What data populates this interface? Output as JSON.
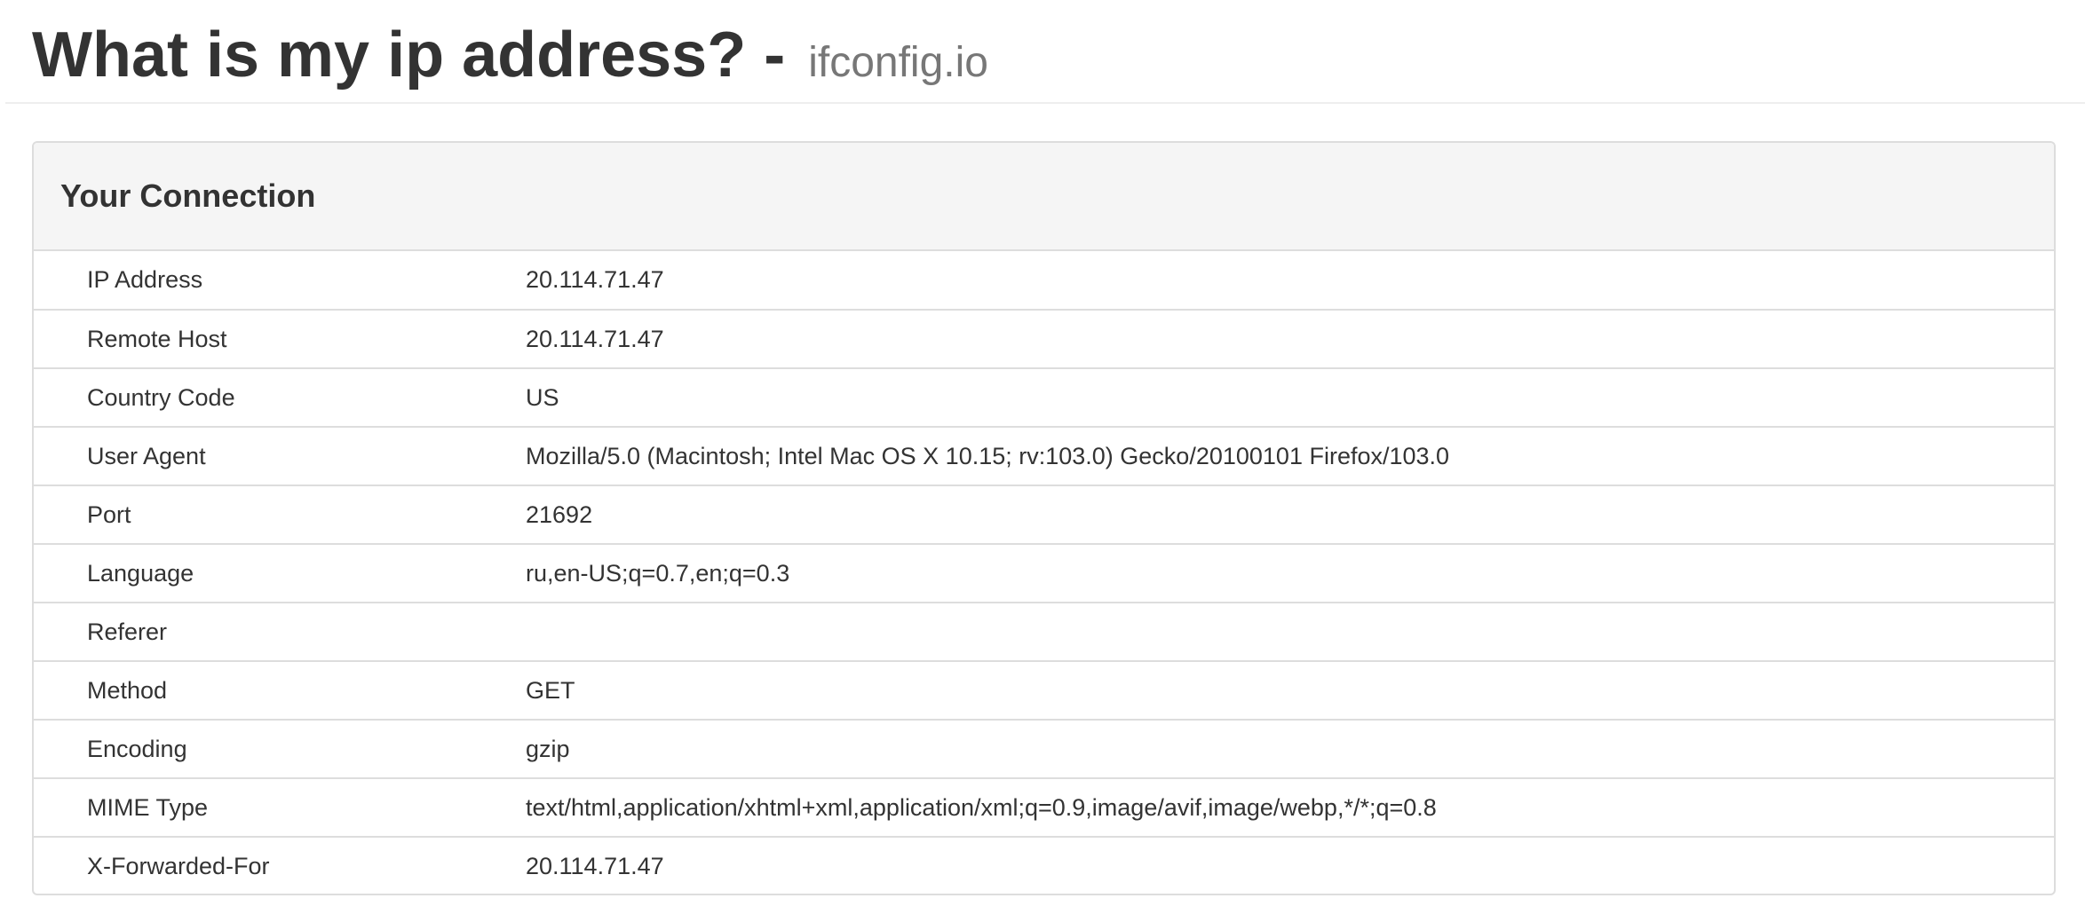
{
  "header": {
    "title": "What is my ip address? -",
    "subtitle": "ifconfig.io"
  },
  "panel": {
    "title": "Your Connection",
    "rows": [
      {
        "label": "IP Address",
        "value": "20.114.71.47"
      },
      {
        "label": "Remote Host",
        "value": "20.114.71.47"
      },
      {
        "label": "Country Code",
        "value": "US"
      },
      {
        "label": "User Agent",
        "value": "Mozilla/5.0 (Macintosh; Intel Mac OS X 10.15; rv:103.0) Gecko/20100101 Firefox/103.0"
      },
      {
        "label": "Port",
        "value": "21692"
      },
      {
        "label": "Language",
        "value": "ru,en-US;q=0.7,en;q=0.3"
      },
      {
        "label": "Referer",
        "value": ""
      },
      {
        "label": "Method",
        "value": "GET"
      },
      {
        "label": "Encoding",
        "value": "gzip"
      },
      {
        "label": "MIME Type",
        "value": "text/html,application/xhtml+xml,application/xml;q=0.9,image/avif,image/webp,*/*;q=0.8"
      },
      {
        "label": "X-Forwarded-For",
        "value": "20.114.71.47"
      }
    ]
  }
}
